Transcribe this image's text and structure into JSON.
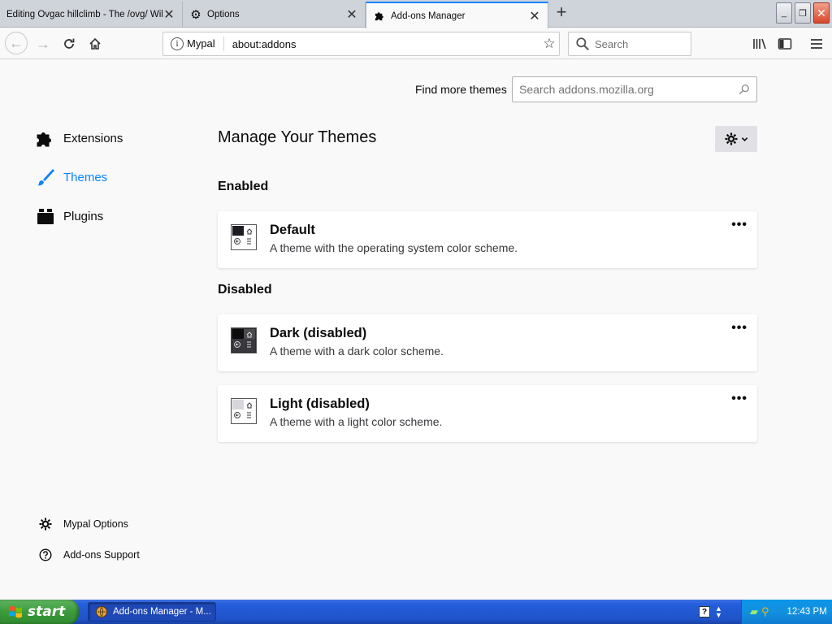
{
  "tabs": [
    {
      "label": "Editing Ovgac hillclimb - The /ovg/ Wiki",
      "icon": "page-icon",
      "active": false
    },
    {
      "label": "Options",
      "icon": "gear-icon",
      "active": false
    },
    {
      "label": "Add-ons Manager",
      "icon": "puzzle-icon",
      "active": true
    }
  ],
  "navbar": {
    "identity": "Mypal",
    "url": "about:addons",
    "search_placeholder": "Search"
  },
  "find_themes": {
    "label": "Find more themes",
    "placeholder": "Search addons.mozilla.org"
  },
  "categories": [
    {
      "label": "Extensions",
      "icon": "puzzle-icon",
      "selected": false
    },
    {
      "label": "Themes",
      "icon": "brush-icon",
      "selected": true
    },
    {
      "label": "Plugins",
      "icon": "plugin-icon",
      "selected": false
    }
  ],
  "footer": {
    "options": "Mypal Options",
    "support": "Add-ons Support"
  },
  "main": {
    "title": "Manage Your Themes",
    "enabled_heading": "Enabled",
    "disabled_heading": "Disabled",
    "more_label": "•••",
    "themes": [
      {
        "name": "Default",
        "description": "A theme with the operating system color scheme.",
        "status": "enabled"
      },
      {
        "name": "Dark (disabled)",
        "description": "A theme with a dark color scheme.",
        "status": "disabled"
      },
      {
        "name": "Light (disabled)",
        "description": "A theme with a light color scheme.",
        "status": "disabled"
      }
    ]
  },
  "taskbar": {
    "start_label": "start",
    "task_label": "Add-ons Manager - M...",
    "clock": "12:43 PM"
  },
  "colors": {
    "accent": "#0a84ff",
    "taskbar": "#245edb",
    "start": "#3c9a3c"
  }
}
